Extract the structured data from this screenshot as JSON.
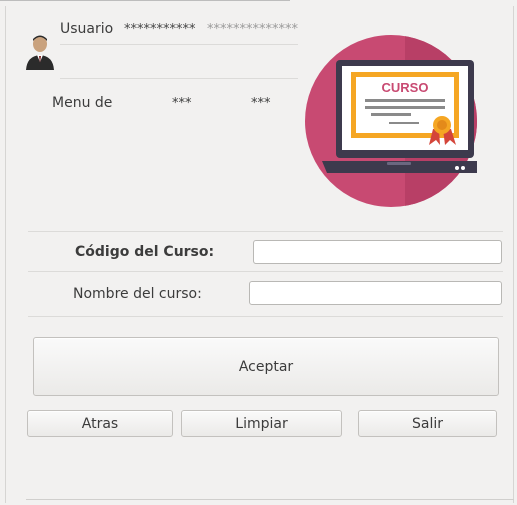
{
  "header": {
    "usuario_label": "Usuario",
    "usuario_value": "***********",
    "usuario_extra": "**************",
    "menu_label": "Menu de",
    "menu_value_1": "***",
    "menu_value_2": "***"
  },
  "logo": {
    "text": "CURSO",
    "icon": "course-certificate-laptop-icon"
  },
  "form": {
    "codigo_label": "Código del Curso:",
    "codigo_value": "",
    "nombre_label": "Nombre del curso:",
    "nombre_value": ""
  },
  "buttons": {
    "aceptar": "Aceptar",
    "atras": "Atras",
    "limpiar": "Limpiar",
    "salir": "Salir"
  },
  "colors": {
    "logo_circle": "#c84a72",
    "logo_accent": "#f5a623",
    "laptop": "#3d3a4d"
  }
}
